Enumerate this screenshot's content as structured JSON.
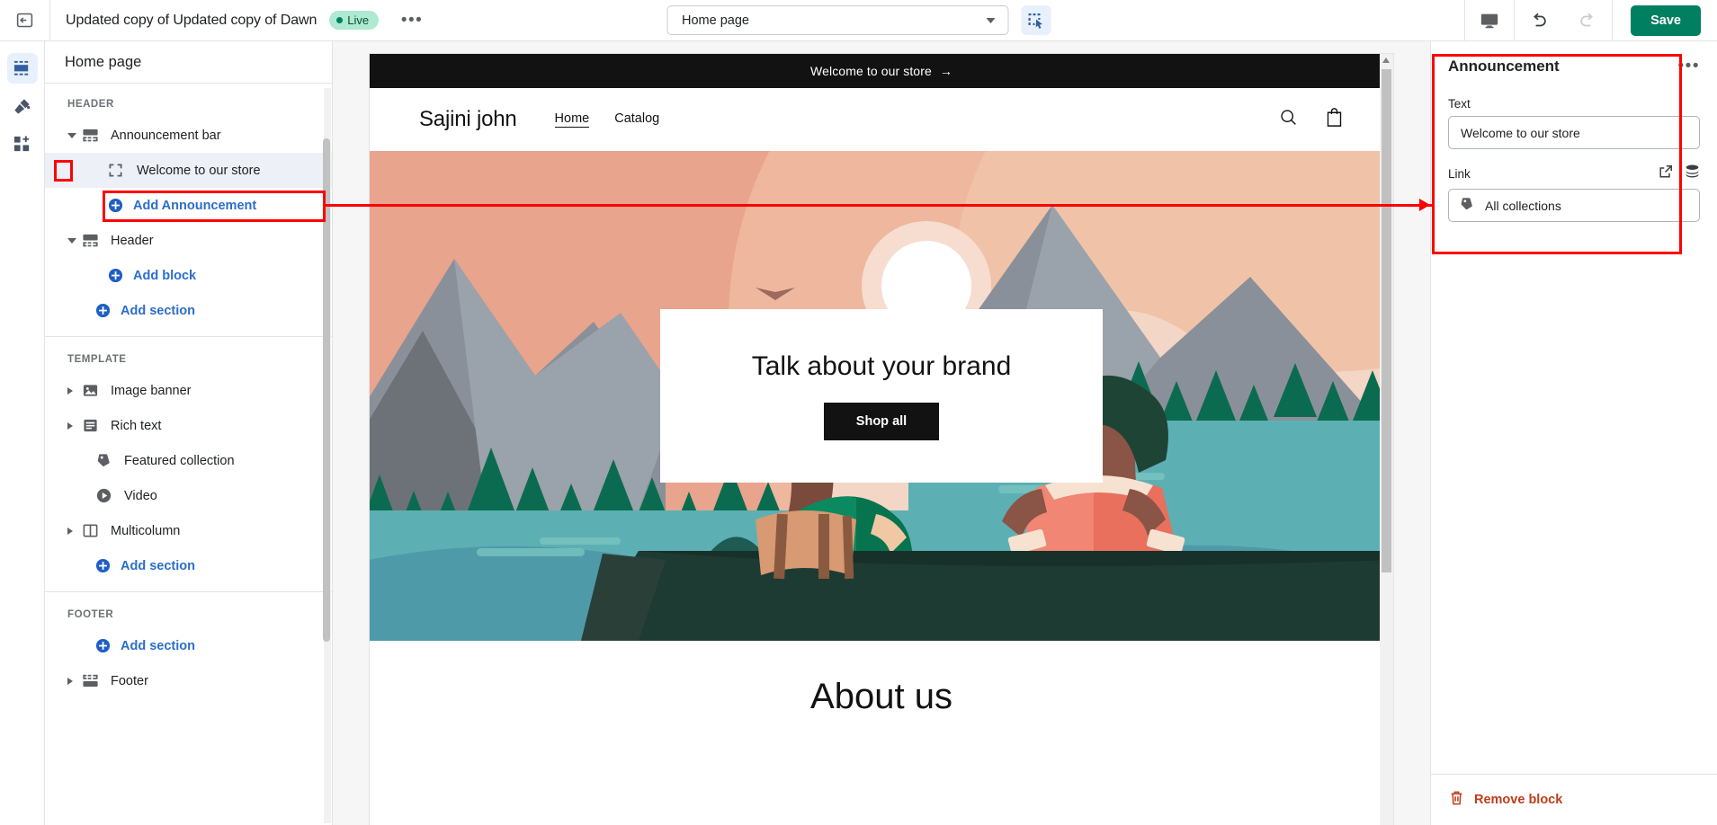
{
  "topbar": {
    "exit_icon": "exit-icon",
    "theme_title": "Updated copy of Updated copy of Dawn",
    "live_label": "Live",
    "more_label": "•••",
    "page_selector_value": "Home page",
    "inspect_icon": "inspector-select-icon",
    "device_icon": "desktop-icon",
    "undo_icon": "undo-icon",
    "redo_icon": "redo-icon",
    "save_label": "Save",
    "accent_color": "#008060",
    "inspect_bg": "#e8f0fe"
  },
  "rail": {
    "items": [
      {
        "icon": "sections-icon",
        "name": "sections",
        "active": true
      },
      {
        "icon": "paint-roller-icon",
        "name": "theme-settings",
        "active": false
      },
      {
        "icon": "apps-grid-plus-icon",
        "name": "apps",
        "active": false
      }
    ]
  },
  "sidebar": {
    "title": "Home page",
    "groups": [
      {
        "label": "HEADER",
        "rows": [
          {
            "label": "Announcement bar",
            "icon": "announcement-bar-icon",
            "caret": "open",
            "indent": 0,
            "type": "section"
          },
          {
            "label": "Welcome to our store",
            "icon": "block-brackets-icon",
            "caret": "none",
            "indent": 2,
            "type": "block",
            "selected": true
          },
          {
            "label": "Add Announcement",
            "icon": "plus-circle-icon",
            "caret": "none",
            "indent": 2,
            "type": "add"
          },
          {
            "label": "Header",
            "icon": "header-icon",
            "caret": "open",
            "indent": 0,
            "type": "section"
          },
          {
            "label": "Add block",
            "icon": "plus-circle-icon",
            "caret": "none",
            "indent": 2,
            "type": "add"
          },
          {
            "label": "Add section",
            "icon": "plus-circle-icon",
            "caret": "none",
            "indent": 1,
            "type": "add"
          }
        ]
      },
      {
        "label": "TEMPLATE",
        "rows": [
          {
            "label": "Image banner",
            "icon": "image-icon",
            "caret": "closed",
            "indent": 0,
            "type": "section"
          },
          {
            "label": "Rich text",
            "icon": "rich-text-icon",
            "caret": "closed",
            "indent": 0,
            "type": "section"
          },
          {
            "label": "Featured collection",
            "icon": "collection-tag-icon",
            "caret": "none",
            "indent": 1,
            "type": "section"
          },
          {
            "label": "Video",
            "icon": "play-circle-icon",
            "caret": "none",
            "indent": 1,
            "type": "section"
          },
          {
            "label": "Multicolumn",
            "icon": "columns-icon",
            "caret": "closed",
            "indent": 0,
            "type": "section"
          },
          {
            "label": "Add section",
            "icon": "plus-circle-icon",
            "caret": "none",
            "indent": 1,
            "type": "add"
          }
        ]
      },
      {
        "label": "FOOTER",
        "rows": [
          {
            "label": "Add section",
            "icon": "plus-circle-icon",
            "caret": "none",
            "indent": 1,
            "type": "add"
          },
          {
            "label": "Footer",
            "icon": "footer-icon",
            "caret": "closed",
            "indent": 0,
            "type": "section"
          }
        ]
      }
    ]
  },
  "preview": {
    "announcement_text": "Welcome to our store",
    "announcement_arrow": "→",
    "store_name": "Sajini john",
    "nav": [
      {
        "label": "Home",
        "active": true
      },
      {
        "label": "Catalog",
        "active": false
      }
    ],
    "search_icon": "search-icon",
    "cart_icon": "cart-icon",
    "hero_title": "Talk about your brand",
    "hero_button": "Shop all",
    "about_title": "About us"
  },
  "right_panel": {
    "title": "Announcement",
    "more_label": "•••",
    "text_field_label": "Text",
    "text_field_value": "Welcome to our store",
    "link_field_label": "Link",
    "link_external_icon": "external-link-icon",
    "link_layers_icon": "layers-icon",
    "link_value": "All collections",
    "link_value_icon": "collection-tag-icon",
    "remove_label": "Remove block",
    "remove_icon": "trash-icon",
    "remove_color": "#bf3c1a"
  }
}
